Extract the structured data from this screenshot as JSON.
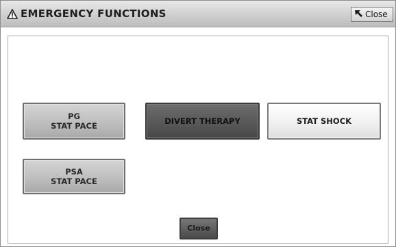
{
  "window": {
    "title": "EMERGENCY FUNCTIONS",
    "close_label": "Close"
  },
  "buttons": {
    "pg_stat_pace": {
      "line1": "PG",
      "line2": "STAT PACE"
    },
    "divert_therapy": {
      "label": "DIVERT THERAPY"
    },
    "stat_shock": {
      "label": "STAT SHOCK"
    },
    "psa_stat_pace": {
      "line1": "PSA",
      "line2": "STAT PACE"
    },
    "close": {
      "label": "Close"
    }
  },
  "icons": {
    "title_icon": "warning-icon",
    "close_icon": "resize-arrow-icon"
  }
}
